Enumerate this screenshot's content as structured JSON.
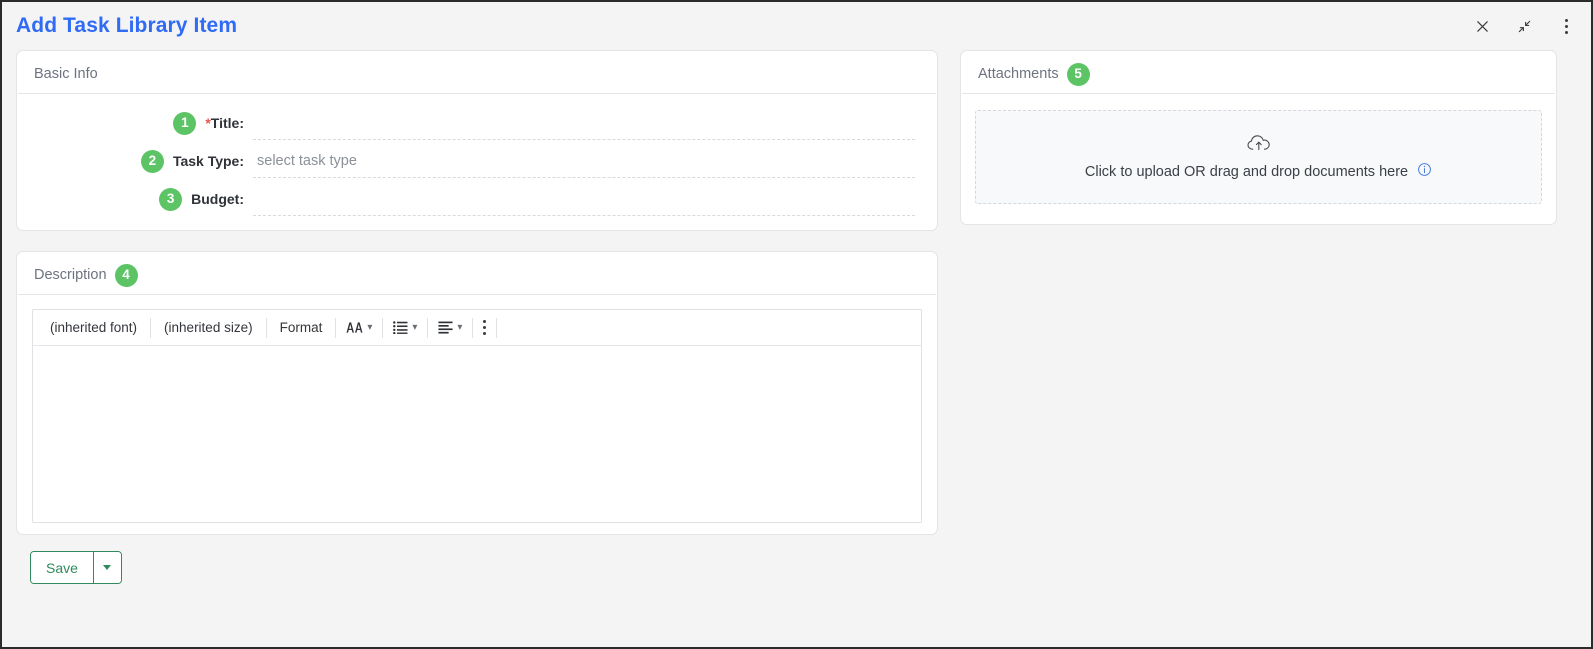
{
  "header": {
    "title": "Add Task Library Item",
    "controls": [
      {
        "name": "close-icon",
        "label": "Close"
      },
      {
        "name": "restore-icon",
        "label": "Restore Down"
      },
      {
        "name": "more-options-icon",
        "label": "More options"
      }
    ]
  },
  "basic_info": {
    "section_title": "Basic Info",
    "fields": [
      {
        "badge": "1",
        "label": "Title:",
        "required": true,
        "value": "",
        "placeholder": ""
      },
      {
        "badge": "2",
        "label": "Task Type:",
        "required": false,
        "value": "",
        "placeholder": "select task type"
      },
      {
        "badge": "3",
        "label": "Budget:",
        "required": false,
        "value": "",
        "placeholder": ""
      }
    ]
  },
  "attachments": {
    "section_title": "Attachments",
    "badge": "5",
    "dropzone_text": "Click to upload OR drag and drop documents here",
    "upload_icon": "cloud-upload-icon",
    "info_icon": "info-circle-icon"
  },
  "description": {
    "section_title": "Description",
    "badge": "4",
    "toolbar": {
      "font_label": "(inherited font)",
      "size_label": "(inherited size)",
      "format_label": "Format",
      "text_style_icon": "font-style-icon",
      "list_icon": "bulleted-list-icon",
      "align_icon": "text-align-icon",
      "overflow_icon": "toolbar-overflow-icon"
    },
    "content": ""
  },
  "footer": {
    "save_label": "Save",
    "save_dropdown_icon": "caret-down-icon"
  },
  "colors": {
    "title_blue": "#2f6bf5",
    "badge_green": "#5cc465",
    "save_green": "#2f8a5d",
    "required_red": "#e8544b",
    "info_blue": "#4a7fe0",
    "page_bg": "#f4f4f5"
  }
}
